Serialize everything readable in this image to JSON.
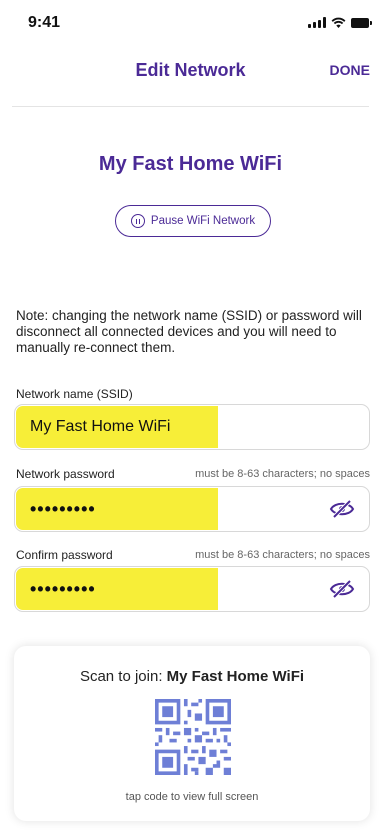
{
  "status_bar": {
    "time": "9:41"
  },
  "nav": {
    "title": "Edit Network",
    "done_label": "DONE"
  },
  "network_title": "My Fast Home WiFi",
  "pause_button": {
    "label": "Pause WiFi Network"
  },
  "note": "Note: changing the network name (SSID) or password will disconnect all connected devices and you will need to manually re-connect them.",
  "fields": {
    "ssid": {
      "label": "Network name (SSID)",
      "value": "My Fast Home WiFi"
    },
    "password": {
      "label": "Network password",
      "hint": "must be 8-63 characters; no spaces",
      "value": "•••••••••"
    },
    "confirm": {
      "label": "Confirm password",
      "hint": "must be 8-63 characters; no spaces",
      "value": "•••••••••"
    }
  },
  "qr_card": {
    "prefix": "Scan to join: ",
    "network_name": "My Fast Home WiFi",
    "hint": "tap code to view full screen"
  },
  "colors": {
    "accent": "#4b2a96",
    "highlight": "#f7ee38",
    "qr": "#6e7fd6"
  }
}
